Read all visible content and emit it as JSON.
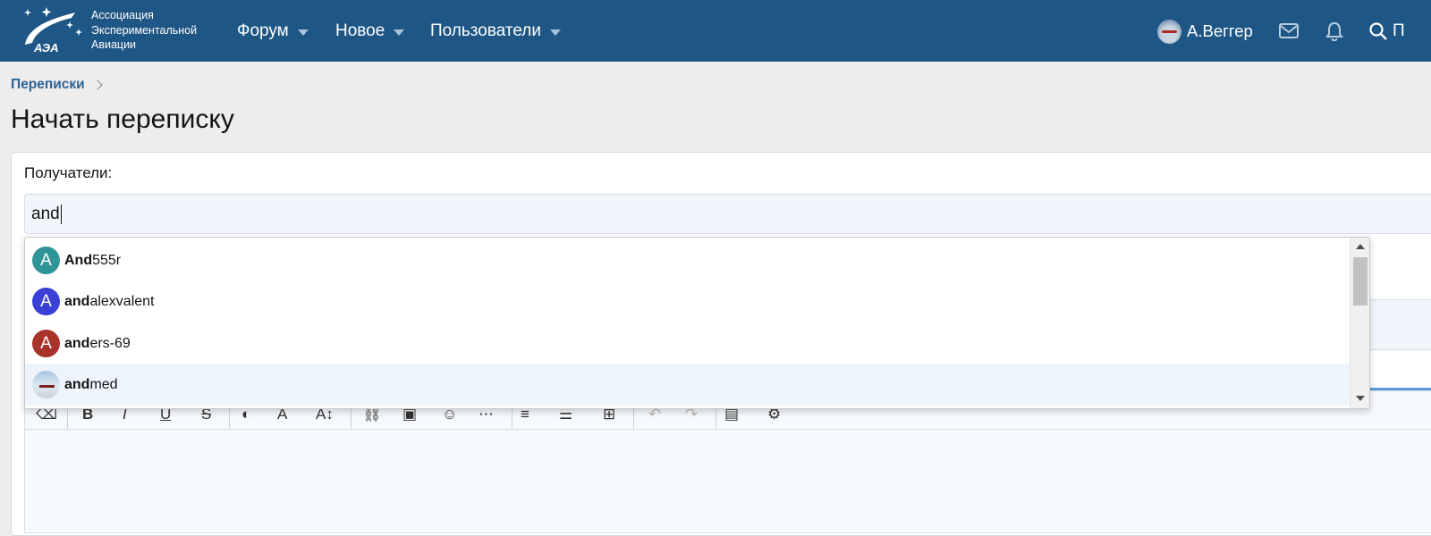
{
  "brand": {
    "logo_mark": "АЭА",
    "name_lines": [
      "Ассоциация",
      "Экспериментальной",
      "Авиации"
    ]
  },
  "nav": {
    "items": [
      {
        "label": "Форум"
      },
      {
        "label": "Новое"
      },
      {
        "label": "Пользователи"
      }
    ],
    "user_name": "А.Веггер",
    "icons": [
      "envelope-icon",
      "bell-icon",
      "search-icon"
    ],
    "search_label_partial": "П"
  },
  "breadcrumb": {
    "items": [
      "Переписки"
    ]
  },
  "page": {
    "title": "Начать переписку"
  },
  "form": {
    "recipients_label": "Получатели:",
    "recipients_value": "and"
  },
  "autocomplete": {
    "options": [
      {
        "avatar_letter": "A",
        "avatar_color": "#2e9497",
        "match": "And",
        "rest": "555r"
      },
      {
        "avatar_letter": "A",
        "avatar_color": "#3a3fd6",
        "match": "and",
        "rest": "alexvalent"
      },
      {
        "avatar_letter": "A",
        "avatar_color": "#a8332b",
        "match": "and",
        "rest": "ers-69"
      },
      {
        "avatar_letter": "",
        "avatar_color": "",
        "match": "and",
        "rest": "med"
      }
    ],
    "highlighted_index": 3
  },
  "colors": {
    "header_bg": "#1e5685",
    "link": "#2a6496",
    "input_bg": "#f1f6fc",
    "highlight_bg": "#eef4fb"
  }
}
